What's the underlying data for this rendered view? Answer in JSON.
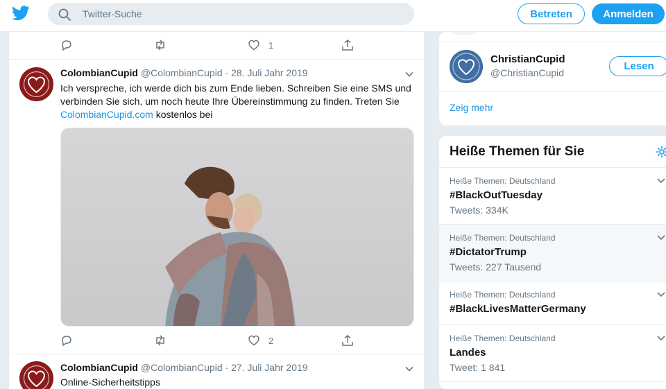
{
  "search": {
    "placeholder": "Twitter-Suche"
  },
  "header": {
    "login_label": "Betreten",
    "signup_label": "Anmelden"
  },
  "colors": {
    "accent": "#1da1f2",
    "link": "#1b95e0",
    "muted": "#657786"
  },
  "top_actions": {
    "reply": "",
    "retweet": "",
    "like": "1",
    "share": ""
  },
  "tweets": [
    {
      "name": "ColombianCupid",
      "handle": "@ColombianCupid",
      "separator": "·",
      "date": "28. Juli Jahr 2019",
      "text_before": "Ich verspreche, ich werde dich bis zum Ende lieben. Schreiben Sie eine SMS und verbinden Sie sich, um noch heute Ihre Übereinstimmung zu finden. Treten Sie ",
      "link": "ColombianCupid.com",
      "text_after": " kostenlos bei",
      "likes": "2"
    },
    {
      "name": "ColombianCupid",
      "handle": "@ColombianCupid",
      "separator": "·",
      "date": "27. Juli Jahr 2019",
      "text": "Online-Sicherheitstipps"
    }
  ],
  "suggestion": {
    "name": "ChristianCupid",
    "handle": "@ChristianCupid",
    "follow_label": "Lesen",
    "more_label": "Zeig mehr"
  },
  "trends": {
    "title": "Heiße Themen für Sie",
    "items": [
      {
        "meta": "Heiße Themen: Deutschland",
        "name": "#BlackOutTuesday",
        "count": "Tweets: 334K"
      },
      {
        "meta": "Heiße Themen: Deutschland",
        "name": "#DictatorTrump",
        "count": "Tweets: 227 Tausend"
      },
      {
        "meta": "Heiße Themen: Deutschland",
        "name": "#BlackLivesMatterGermany",
        "count": ""
      },
      {
        "meta": "Heiße Themen: Deutschland",
        "name": "Landes",
        "count": "Tweet: 1 841"
      }
    ]
  }
}
